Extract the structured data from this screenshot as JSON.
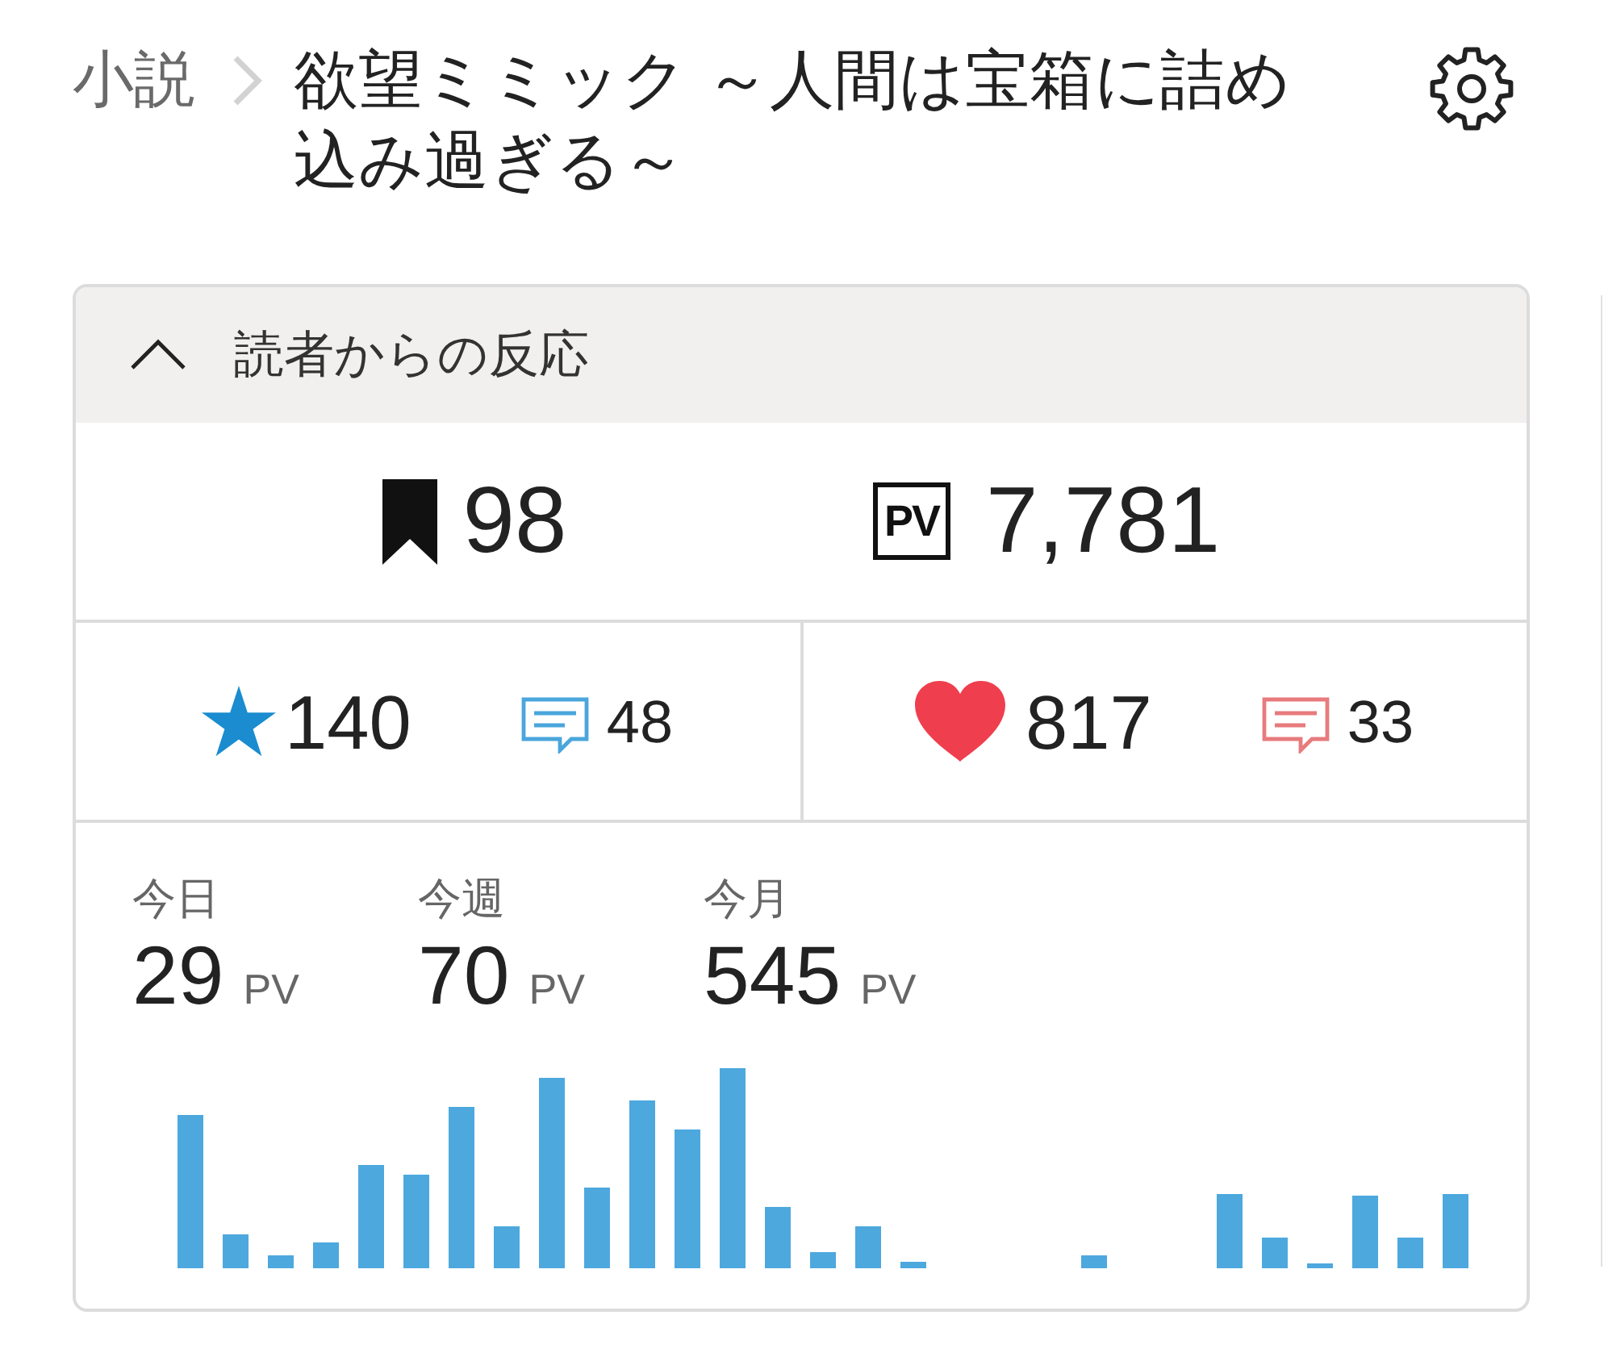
{
  "breadcrumb": {
    "parent": "小説",
    "title": "欲望ミミック ～人間は宝箱に詰め込み過ぎる～"
  },
  "reactions": {
    "title": "読者からの反応",
    "expanded": true,
    "totals": [
      {
        "kind": "bookmarks",
        "value": "98"
      },
      {
        "kind": "page_views",
        "badge": "PV",
        "value": "7,781"
      }
    ],
    "ratings": [
      {
        "kind": "stars",
        "count": "140",
        "comments": "48"
      },
      {
        "kind": "hearts",
        "count": "817",
        "comments": "33"
      }
    ],
    "periods": [
      {
        "label": "今日",
        "value": "29",
        "unit": "PV"
      },
      {
        "label": "今週",
        "value": "70",
        "unit": "PV"
      },
      {
        "label": "今月",
        "value": "545",
        "unit": "PV"
      }
    ]
  }
}
